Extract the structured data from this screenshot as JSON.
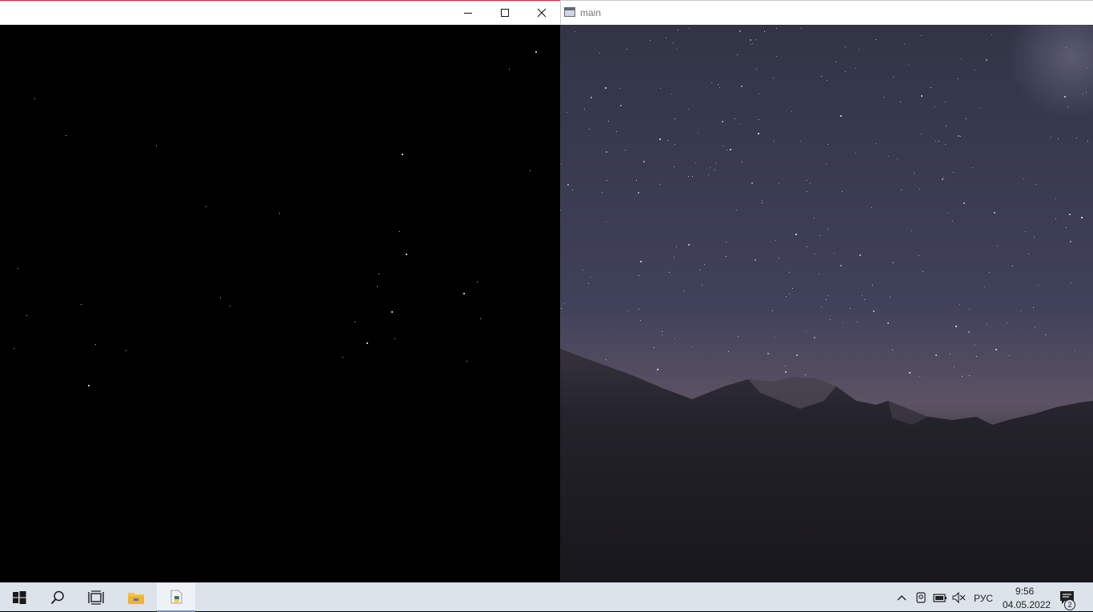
{
  "windows": {
    "left": {
      "title": "",
      "caption_buttons": [
        "minimize",
        "maximize",
        "close"
      ]
    },
    "right": {
      "title": "main",
      "icon": "app-window-icon"
    }
  },
  "taskbar": {
    "buttons": [
      {
        "name": "start-button",
        "icon": "windows-logo-icon"
      },
      {
        "name": "search-button",
        "icon": "search-icon"
      },
      {
        "name": "task-view-button",
        "icon": "task-view-icon"
      },
      {
        "name": "file-explorer-button",
        "icon": "folder-icon"
      },
      {
        "name": "python-app-button",
        "icon": "python-icon",
        "active": true
      }
    ],
    "tray": {
      "icons": [
        "chevron-up-icon",
        "camera-icon",
        "battery-icon",
        "volume-muted-icon"
      ],
      "language": "РУС",
      "time": "9:56",
      "date": "04.05.2022",
      "notification_count": "2"
    }
  },
  "colors": {
    "accent": "#e81123",
    "taskbar_bg": "#dde3ea",
    "active_indicator": "#6c90c0"
  }
}
